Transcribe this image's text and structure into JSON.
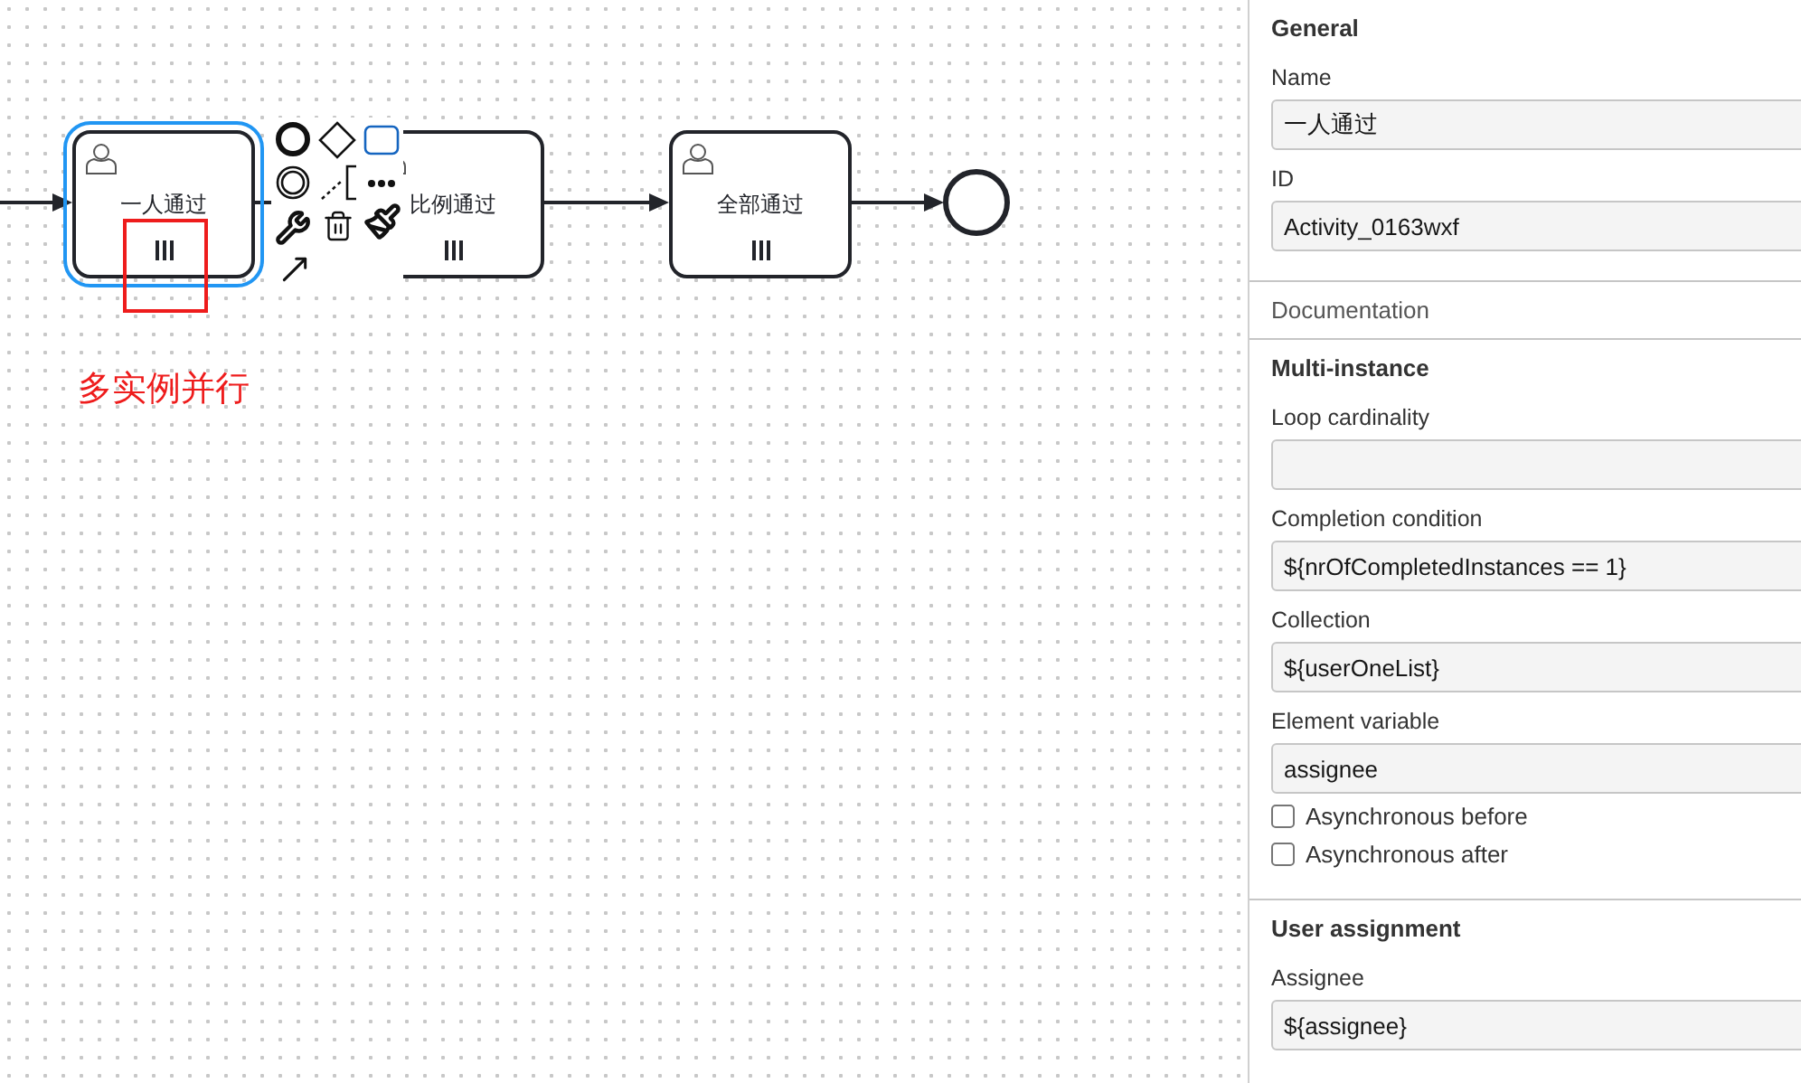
{
  "canvas": {
    "tasks": [
      {
        "name": "一人通过",
        "selected": true,
        "multi_instance": true
      },
      {
        "name": "比例通过",
        "selected": false,
        "multi_instance": true
      },
      {
        "name": "全部通过",
        "selected": false,
        "multi_instance": true
      }
    ],
    "annotation": {
      "text": "多实例并行"
    }
  },
  "panel": {
    "sections": [
      {
        "title": "General",
        "kind": "group",
        "fields": [
          {
            "kind": "text",
            "label": "Name",
            "value": "一人通过"
          },
          {
            "kind": "text",
            "label": "ID",
            "value": "Activity_0163wxf"
          }
        ]
      },
      {
        "title": "Documentation",
        "kind": "collapsed"
      },
      {
        "title": "Multi-instance",
        "kind": "group",
        "fields": [
          {
            "kind": "text",
            "label": "Loop cardinality"
          },
          {
            "kind": "text",
            "label": "Completion condition",
            "value": "${nrOfCompletedInstances == 1}"
          },
          {
            "kind": "text",
            "label": "Collection",
            "value": "${userOneList}"
          },
          {
            "kind": "text",
            "label": "Element variable",
            "value": "assignee"
          },
          {
            "kind": "checkbox",
            "label": "Asynchronous before",
            "checked": false
          },
          {
            "kind": "checkbox",
            "label": "Asynchronous after",
            "checked": false
          }
        ]
      },
      {
        "title": "User assignment",
        "kind": "group",
        "fields": [
          {
            "kind": "text",
            "label": "Assignee",
            "value": "${assignee}"
          }
        ]
      }
    ]
  }
}
